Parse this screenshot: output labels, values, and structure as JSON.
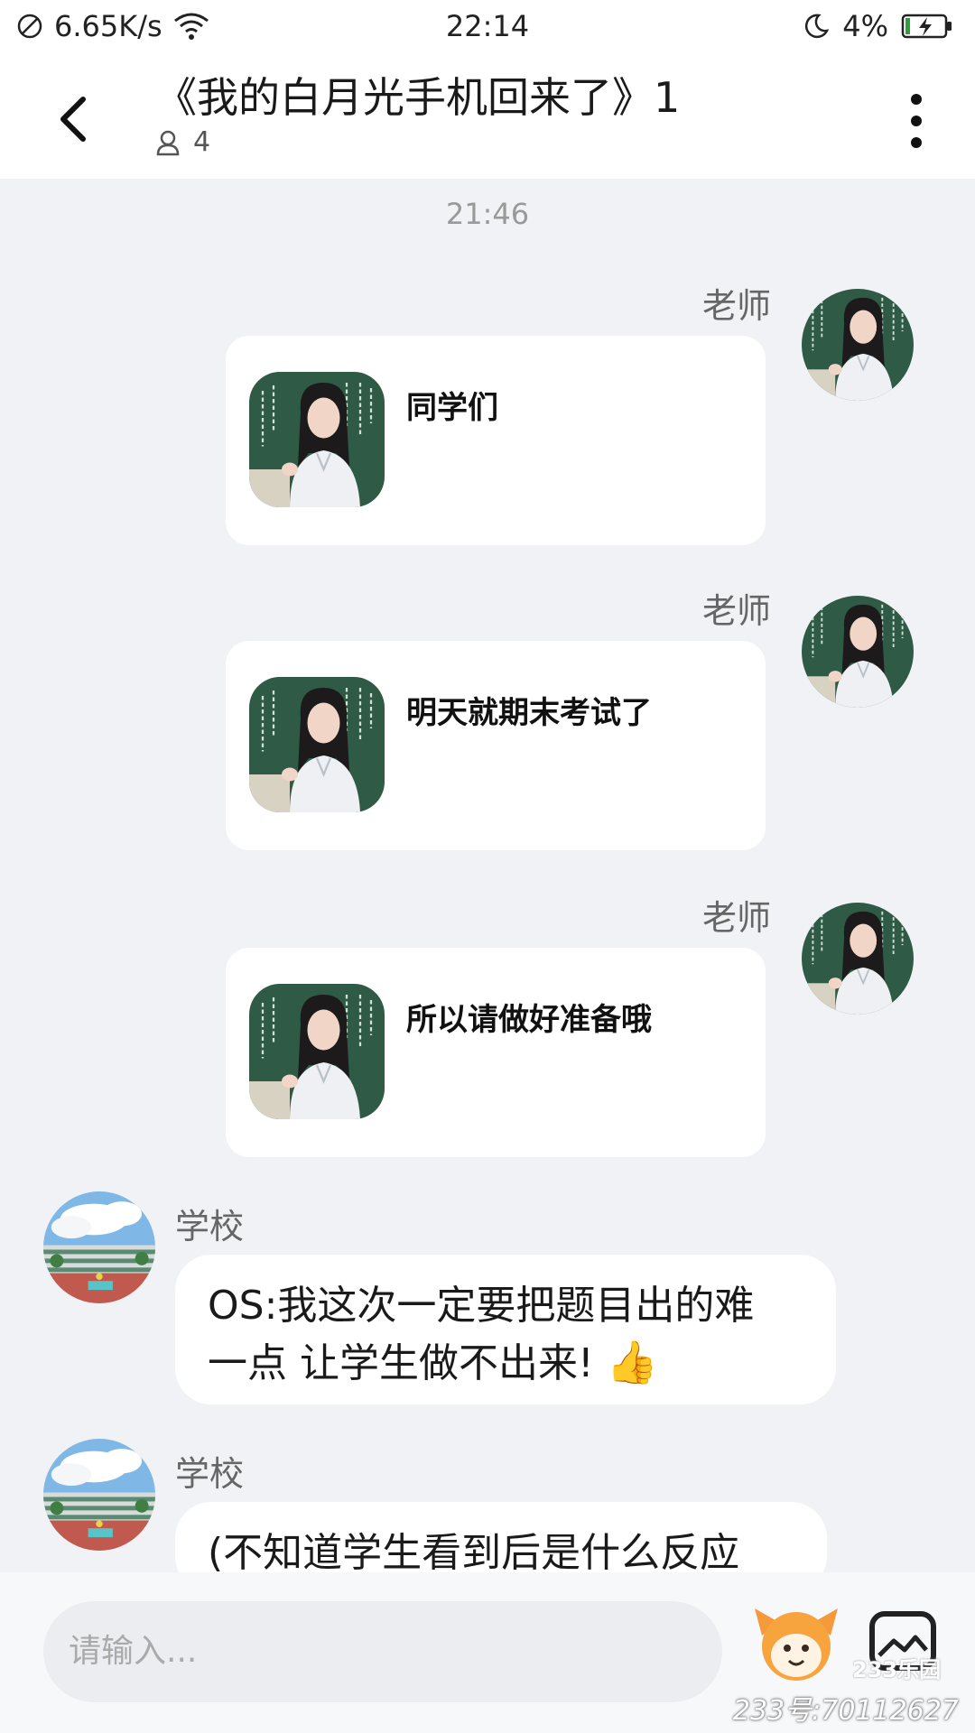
{
  "status_bar": {
    "speed": "6.65K/s",
    "time": "22:14",
    "battery": "4%"
  },
  "header": {
    "title": "《我的白月光手机回来了》1",
    "member_count": "4"
  },
  "chat": {
    "timestamp": "21:46",
    "messages": [
      {
        "sender": "老师",
        "text": "同学们"
      },
      {
        "sender": "老师",
        "text": "明天就期末考试了"
      },
      {
        "sender": "老师",
        "text": "所以请做好准备哦"
      },
      {
        "sender": "学校",
        "line1": "OS:我这次一定要把题目出的难",
        "line2": "一点 让学生做不出来!",
        "emoji": "👍"
      },
      {
        "sender": "学校",
        "text": "(不知道学生看到后是什么反应"
      }
    ]
  },
  "input": {
    "placeholder": "请输入..."
  },
  "watermark": {
    "id": "233号:70112627",
    "logo": "233乐园"
  },
  "colors": {
    "background": "#f0f2f5",
    "bubble": "#ffffff",
    "chalkboard": "#2f5a45"
  },
  "icons": [
    "no-signal-icon",
    "wifi-icon",
    "moon-icon",
    "battery-charging-icon",
    "back-icon",
    "person-icon",
    "more-vertical-icon",
    "emoji-face-icon",
    "image-icon",
    "thumbs-up-icon"
  ]
}
